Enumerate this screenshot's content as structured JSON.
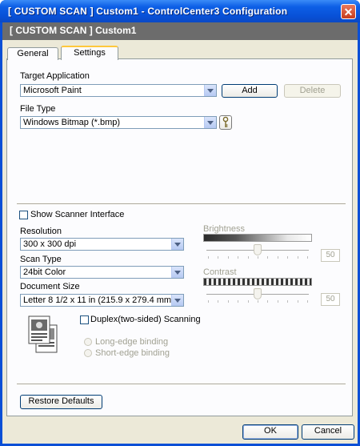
{
  "window": {
    "title": "[ CUSTOM SCAN ]   Custom1 - ControlCenter3 Configuration",
    "close_glyph": "✕"
  },
  "header": {
    "title": "[ CUSTOM SCAN ]   Custom1"
  },
  "tabs": [
    {
      "label": "General",
      "active": false
    },
    {
      "label": "Settings",
      "active": true
    }
  ],
  "target_application": {
    "label": "Target Application",
    "value": "Microsoft Paint",
    "add_label": "Add",
    "delete_label": "Delete"
  },
  "file_type": {
    "label": "File Type",
    "value": "Windows Bitmap (*.bmp)",
    "key_icon": "key-icon"
  },
  "show_scanner_interface": {
    "label": "Show Scanner Interface",
    "checked": false
  },
  "resolution": {
    "label": "Resolution",
    "value": "300 x 300 dpi"
  },
  "scan_type": {
    "label": "Scan Type",
    "value": "24bit Color"
  },
  "document_size": {
    "label": "Document Size",
    "value": "Letter 8 1/2 x 11 in (215.9 x 279.4 mm)"
  },
  "brightness": {
    "label": "Brightness",
    "value": "50",
    "level": 0.5
  },
  "contrast": {
    "label": "Contrast",
    "value": "50",
    "level": 0.5
  },
  "duplex": {
    "label": "Duplex(two-sided) Scanning",
    "checked": false,
    "icon": "duplex-pages-icon",
    "options": [
      "Long-edge binding",
      "Short-edge binding"
    ]
  },
  "restore_defaults_label": "Restore Defaults",
  "ok_label": "OK",
  "cancel_label": "Cancel",
  "colors": {
    "titlebar": "#0a4fd6",
    "header": "#6c6c6c",
    "dialog": "#ece9d8",
    "tab_highlight": "#ffc83c"
  }
}
